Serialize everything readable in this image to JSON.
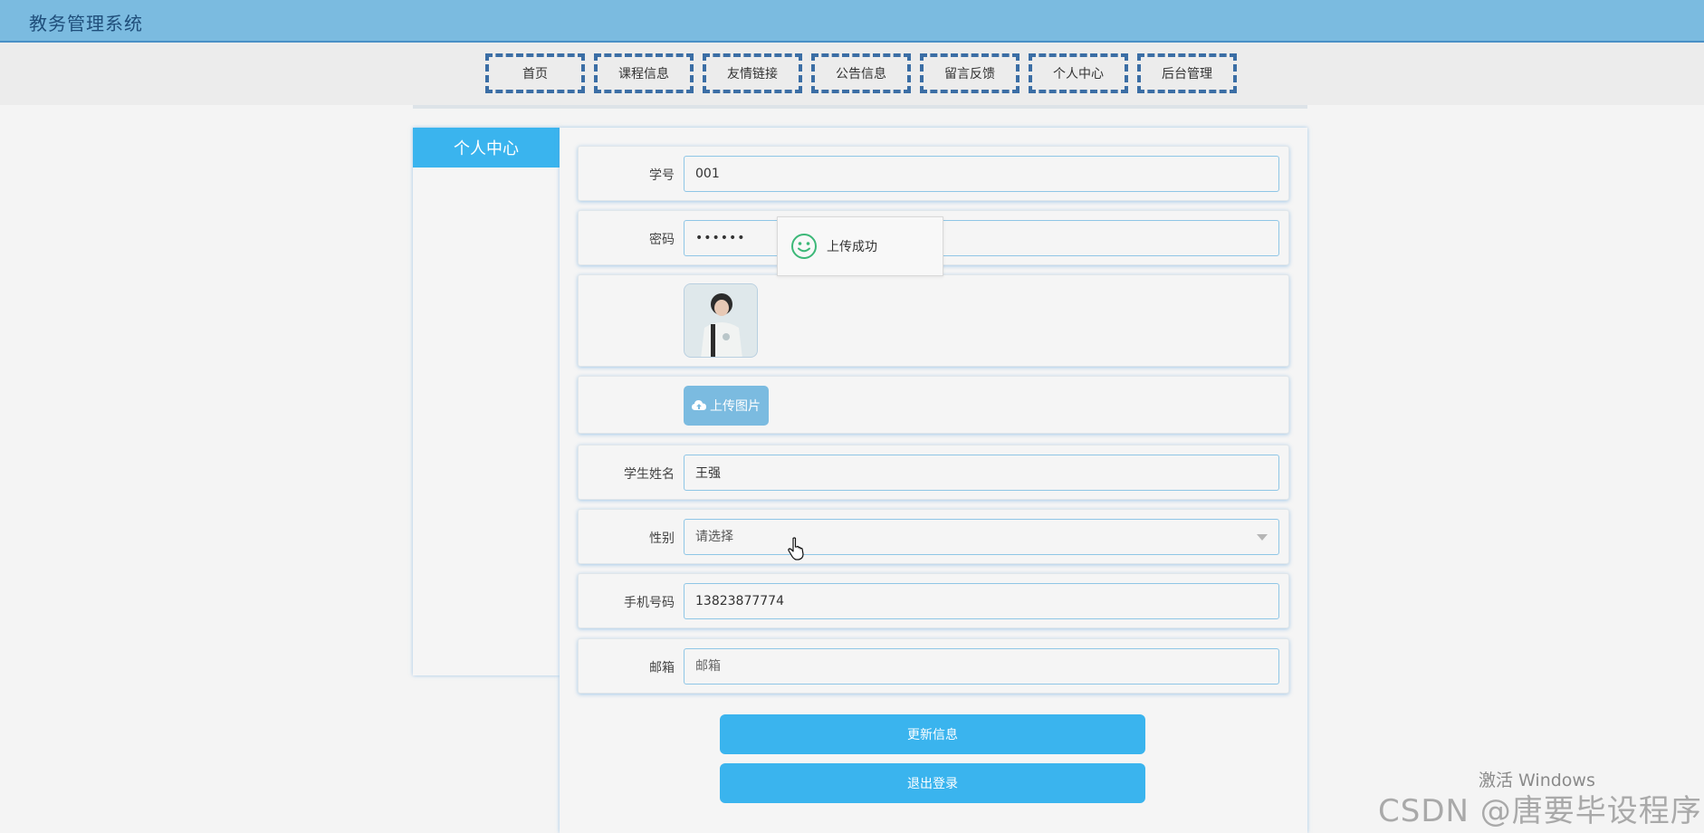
{
  "app": {
    "title": "教务管理系统"
  },
  "nav": {
    "items": [
      {
        "label": "首页"
      },
      {
        "label": "课程信息"
      },
      {
        "label": "友情链接"
      },
      {
        "label": "公告信息"
      },
      {
        "label": "留言反馈"
      },
      {
        "label": "个人中心"
      },
      {
        "label": "后台管理"
      }
    ]
  },
  "sidebar": {
    "header": "个人中心"
  },
  "form": {
    "student_id": {
      "label": "学号",
      "value": "001"
    },
    "password": {
      "label": "密码",
      "value": "••••••"
    },
    "upload_button": "上传图片",
    "student_name": {
      "label": "学生姓名",
      "value": "王强"
    },
    "gender": {
      "label": "性别",
      "placeholder": "请选择"
    },
    "phone": {
      "label": "手机号码",
      "value": "13823877774"
    },
    "email": {
      "label": "邮箱",
      "placeholder": "邮箱"
    }
  },
  "actions": {
    "update": "更新信息",
    "logout": "退出登录"
  },
  "toast": {
    "message": "上传成功"
  },
  "watermarks": {
    "windows": "激活 Windows",
    "csdn": "CSDN @唐要毕设程序"
  },
  "colors": {
    "topbar": "#7bbbe0",
    "accent": "#3ab4ee",
    "nav_border": "#3b6ea5",
    "success": "#3cb878"
  }
}
